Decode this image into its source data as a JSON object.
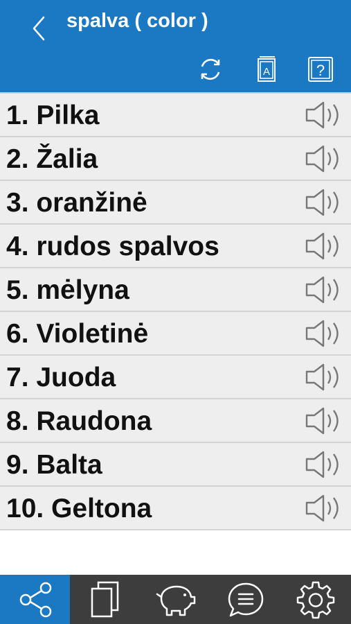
{
  "header": {
    "title": "spalva ( color )",
    "back_icon": "chevron-left-icon",
    "actions": [
      {
        "name": "refresh-button",
        "icon": "refresh-icon"
      },
      {
        "name": "dictionary-button",
        "icon": "book-icon"
      },
      {
        "name": "help-button",
        "icon": "help-icon"
      }
    ]
  },
  "words": [
    {
      "text": "1. Pilka"
    },
    {
      "text": "2. Žalia"
    },
    {
      "text": "3. oranžinė"
    },
    {
      "text": "4. rudos spalvos"
    },
    {
      "text": "5. mėlyna"
    },
    {
      "text": "6. Violetinė"
    },
    {
      "text": "7. Juoda"
    },
    {
      "text": "8. Raudona"
    },
    {
      "text": "9. Balta"
    },
    {
      "text": "10. Geltona"
    }
  ],
  "tabbar": {
    "items": [
      {
        "name": "share",
        "icon": "share-icon",
        "active": true
      },
      {
        "name": "cards",
        "icon": "cards-icon",
        "active": false
      },
      {
        "name": "savings",
        "icon": "piggy-bank-icon",
        "active": false
      },
      {
        "name": "chat",
        "icon": "chat-icon",
        "active": false
      },
      {
        "name": "settings",
        "icon": "gear-icon",
        "active": false
      }
    ]
  },
  "colors": {
    "accent": "#1b78c2",
    "tabbar_bg": "#3d3d3d",
    "row_bg": "#eeeeee",
    "icon_gray": "#777777"
  }
}
